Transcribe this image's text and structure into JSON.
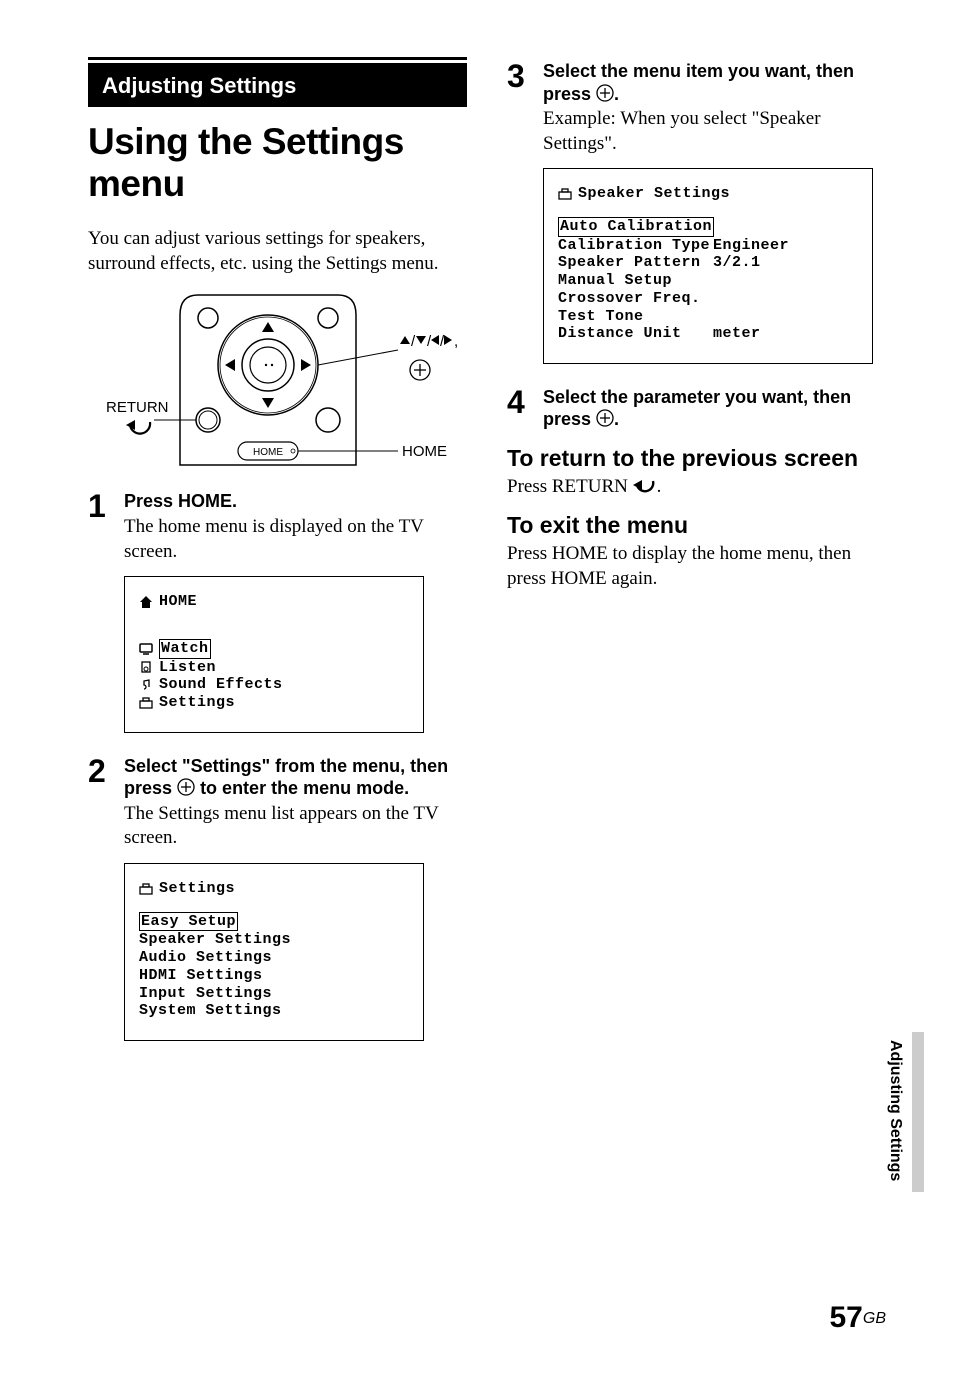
{
  "left": {
    "sectionHeader": "Adjusting Settings",
    "title": "Using the Settings menu",
    "intro": "You can adjust various settings for speakers, surround effects, etc. using the Settings menu.",
    "diagram": {
      "returnLabel": "RETURN",
      "homeLabel": "HOME",
      "homeButton": "HOME",
      "arrowsLabel": ",",
      "plusAria": "enter"
    },
    "step1": {
      "num": "1",
      "head": "Press HOME.",
      "desc": "The home menu is displayed on the TV screen.",
      "screen": {
        "title": "HOME",
        "items": [
          "Watch",
          "Listen",
          "Sound Effects",
          "Settings"
        ],
        "selectedIndex": 0
      }
    },
    "step2": {
      "num": "2",
      "headA": "Select \"Settings\" from the menu, then press ",
      "headB": " to enter the menu mode.",
      "desc": "The Settings menu list appears on the TV screen.",
      "screen": {
        "title": "Settings",
        "items": [
          "Easy Setup",
          "Speaker Settings",
          "Audio Settings",
          "HDMI Settings",
          "Input Settings",
          "System Settings"
        ],
        "selectedIndex": 0
      }
    }
  },
  "right": {
    "step3": {
      "num": "3",
      "headA": "Select the menu item you want, then press ",
      "headB": ".",
      "desc": "Example: When you select \"Speaker Settings\".",
      "screen": {
        "title": "Speaker Settings",
        "rows": [
          {
            "label": "Auto Calibration",
            "value": "",
            "selected": true
          },
          {
            "label": "Calibration Type",
            "value": "Engineer"
          },
          {
            "label": "Speaker Pattern",
            "value": "3/2.1"
          },
          {
            "label": "Manual Setup",
            "value": ""
          },
          {
            "label": "Crossover Freq.",
            "value": ""
          },
          {
            "label": "Test Tone",
            "value": ""
          },
          {
            "label": "Distance Unit",
            "value": "meter"
          }
        ]
      }
    },
    "step4": {
      "num": "4",
      "headA": "Select the parameter you want, then press ",
      "headB": "."
    },
    "returnHeading": "To return to the previous screen",
    "returnBodyA": "Press RETURN ",
    "returnBodyB": ".",
    "exitHeading": "To exit the menu",
    "exitBody": "Press HOME to display the home menu, then press HOME again."
  },
  "sideTab": "Adjusting Settings",
  "pageNumber": "57",
  "pageSuffix": "GB"
}
